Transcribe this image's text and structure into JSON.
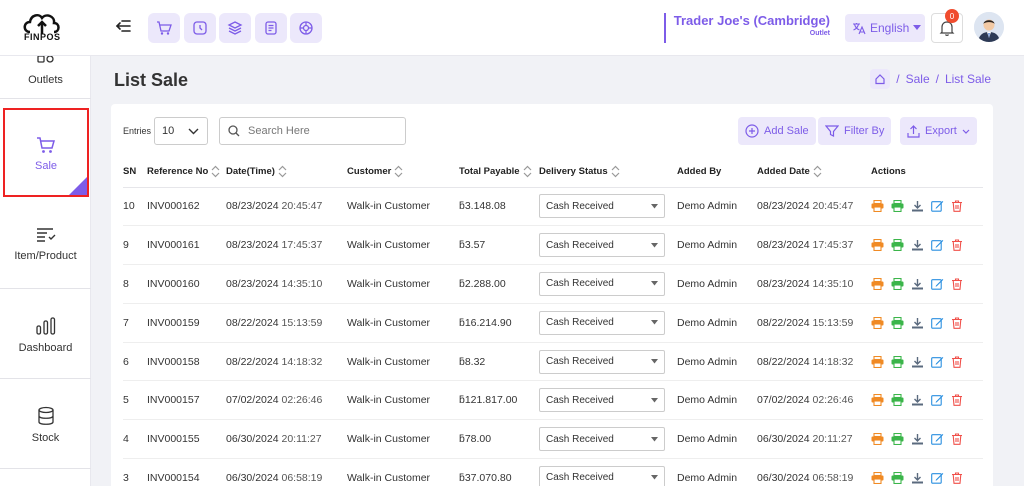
{
  "app": {
    "logo_text": "FINPOS"
  },
  "header": {
    "store_name": "Trader Joe's (Cambridge)",
    "store_type": "Outlet",
    "language": "English",
    "notification_count": "0"
  },
  "sidebar": {
    "items": [
      {
        "label": "Outlets",
        "icon": "outlets-icon"
      },
      {
        "label": "Sale",
        "icon": "cart-icon",
        "active": true
      },
      {
        "label": "Item/Product",
        "icon": "item-icon"
      },
      {
        "label": "Dashboard",
        "icon": "chart-icon"
      },
      {
        "label": "Stock",
        "icon": "database-icon"
      }
    ]
  },
  "page": {
    "title": "List Sale",
    "breadcrumb": [
      "Sale",
      "List Sale"
    ]
  },
  "toolbar": {
    "entries_label": "Entries",
    "entries_value": "10",
    "search_placeholder": "Search Here",
    "add_label": "Add Sale",
    "filter_label": "Filter By",
    "export_label": "Export"
  },
  "table": {
    "headers": [
      "SN",
      "Reference No",
      "Date(Time)",
      "Customer",
      "Total Payable",
      "Delivery Status",
      "Added By",
      "Added Date",
      "Actions"
    ],
    "rows": [
      {
        "sn": "10",
        "ref": "INV000162",
        "date": "08/23/2024",
        "time": "20:45:47",
        "customer": "Walk-in Customer",
        "total": "ƃ3.148.08",
        "status": "Cash Received",
        "added_by": "Demo Admin",
        "added_date": "08/23/2024",
        "added_time": "20:45:47"
      },
      {
        "sn": "9",
        "ref": "INV000161",
        "date": "08/23/2024",
        "time": "17:45:37",
        "customer": "Walk-in Customer",
        "total": "ƃ3.57",
        "status": "Cash Received",
        "added_by": "Demo Admin",
        "added_date": "08/23/2024",
        "added_time": "17:45:37"
      },
      {
        "sn": "8",
        "ref": "INV000160",
        "date": "08/23/2024",
        "time": "14:35:10",
        "customer": "Walk-in Customer",
        "total": "ƃ2.288.00",
        "status": "Cash Received",
        "added_by": "Demo Admin",
        "added_date": "08/23/2024",
        "added_time": "14:35:10"
      },
      {
        "sn": "7",
        "ref": "INV000159",
        "date": "08/22/2024",
        "time": "15:13:59",
        "customer": "Walk-in Customer",
        "total": "ƃ16.214.90",
        "status": "Cash Received",
        "added_by": "Demo Admin",
        "added_date": "08/22/2024",
        "added_time": "15:13:59"
      },
      {
        "sn": "6",
        "ref": "INV000158",
        "date": "08/22/2024",
        "time": "14:18:32",
        "customer": "Walk-in Customer",
        "total": "ƃ8.32",
        "status": "Cash Received",
        "added_by": "Demo Admin",
        "added_date": "08/22/2024",
        "added_time": "14:18:32"
      },
      {
        "sn": "5",
        "ref": "INV000157",
        "date": "07/02/2024",
        "time": "02:26:46",
        "customer": "Walk-in Customer",
        "total": "ƃ121.817.00",
        "status": "Cash Received",
        "added_by": "Demo Admin",
        "added_date": "07/02/2024",
        "added_time": "02:26:46"
      },
      {
        "sn": "4",
        "ref": "INV000155",
        "date": "06/30/2024",
        "time": "20:11:27",
        "customer": "Walk-in Customer",
        "total": "ƃ78.00",
        "status": "Cash Received",
        "added_by": "Demo Admin",
        "added_date": "06/30/2024",
        "added_time": "20:11:27"
      },
      {
        "sn": "3",
        "ref": "INV000154",
        "date": "06/30/2024",
        "time": "06:58:19",
        "customer": "Walk-in Customer",
        "total": "ƃ37.070.80",
        "status": "Cash Received",
        "added_by": "Demo Admin",
        "added_date": "06/30/2024",
        "added_time": "06:58:19"
      }
    ]
  },
  "colors": {
    "accent": "#7d5ce8",
    "accent_light": "#ece8fb",
    "print_orange": "#f08a24",
    "print_green": "#3bb54a",
    "download": "#5a6a7e",
    "edit_blue": "#2a8fe0",
    "delete_red": "#f0504a"
  }
}
